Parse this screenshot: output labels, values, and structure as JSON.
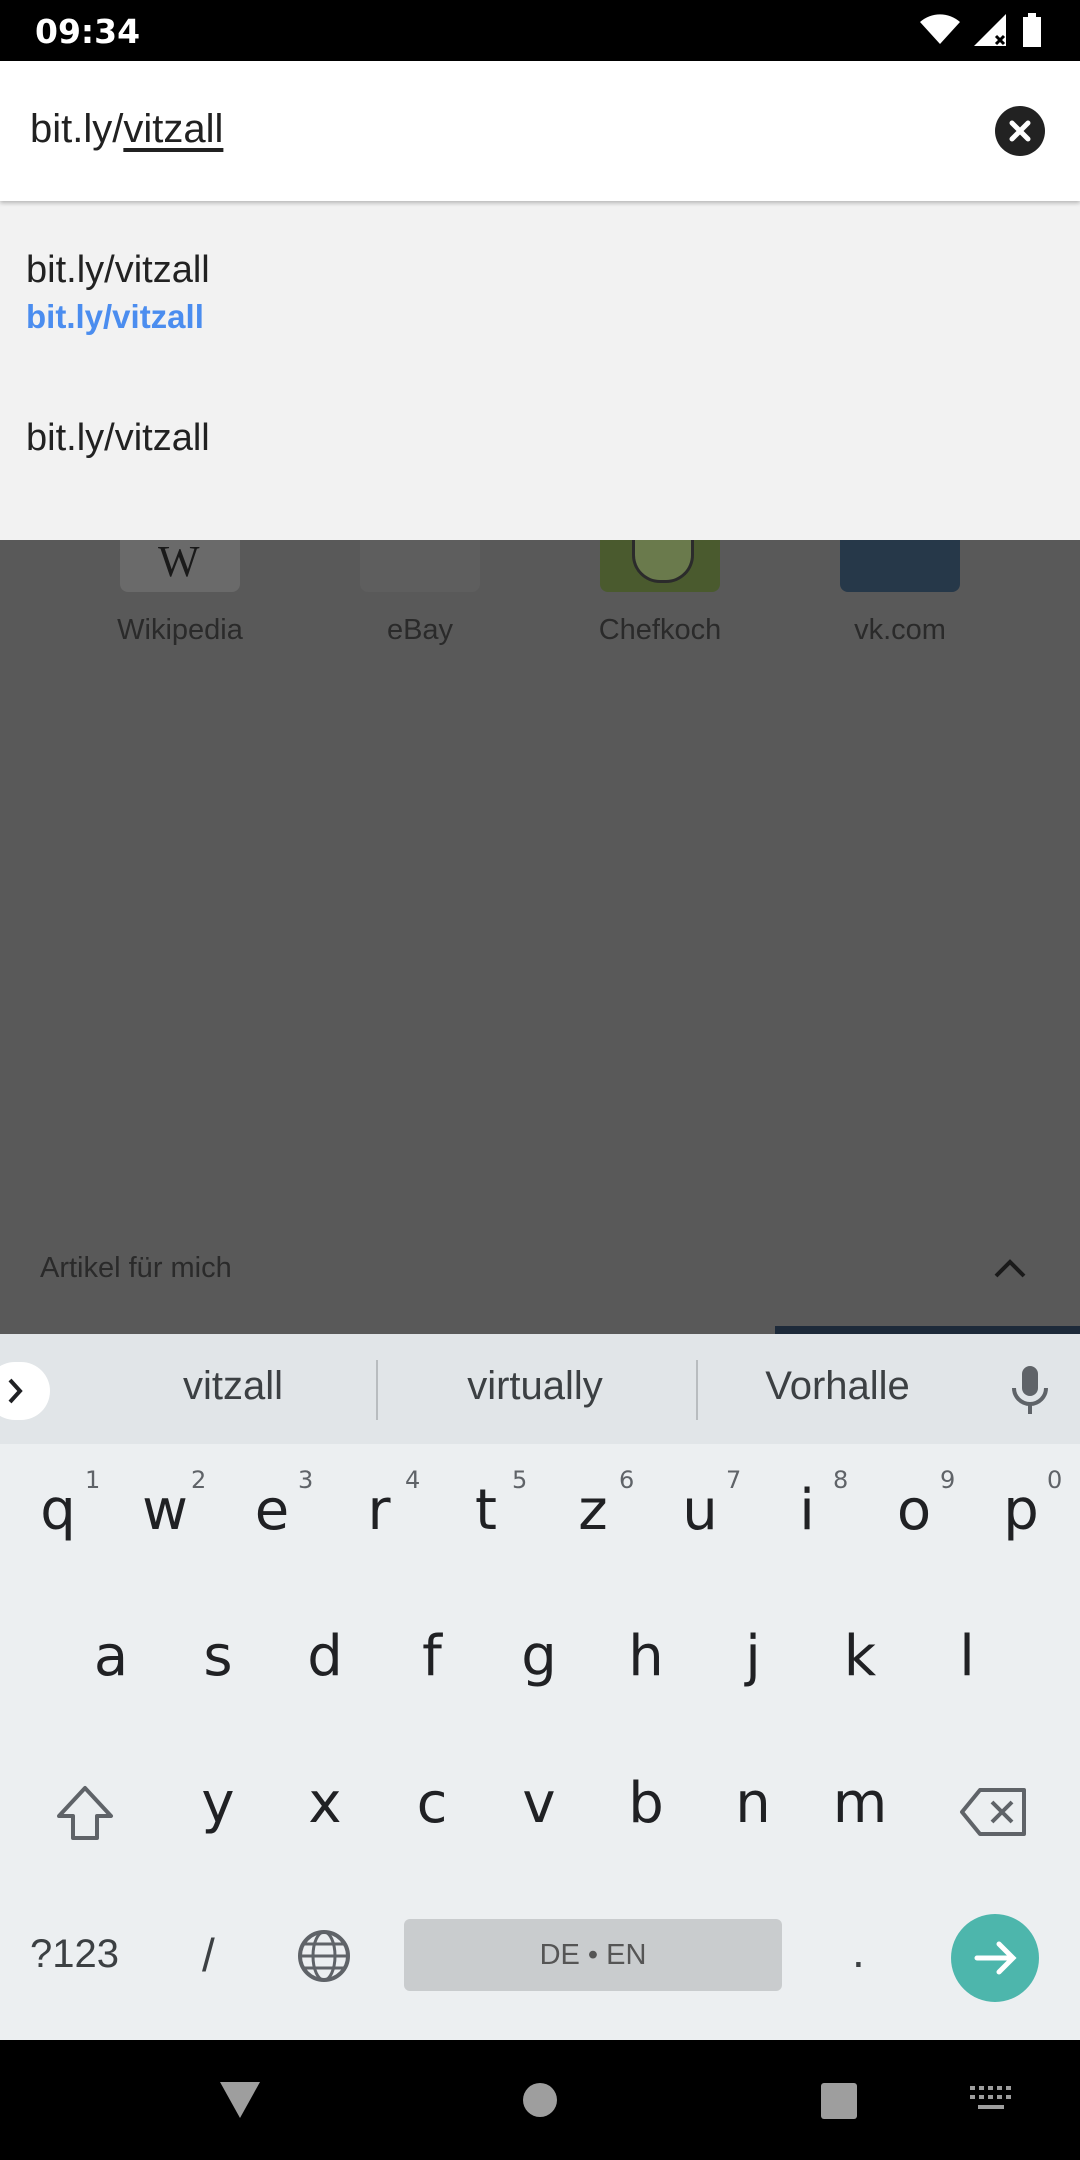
{
  "status_bar": {
    "time": "09:34",
    "icons": [
      "wifi-icon",
      "signal-icon",
      "battery-icon"
    ]
  },
  "url_bar": {
    "prefix": "bit.ly/",
    "typed": "vitzall"
  },
  "suggestions": [
    {
      "title": "bit.ly/vitzall",
      "url": "bit.ly/vitzall"
    },
    {
      "title": "bit.ly/vitzall"
    }
  ],
  "tiles": [
    {
      "label": "Wikipedia",
      "color": "#f0f0f0"
    },
    {
      "label": "eBay",
      "color": "#f4f4f4"
    },
    {
      "label": "Chefkoch",
      "color": "#8bc34a"
    },
    {
      "label": "vk.com",
      "color": "#4a76a8"
    }
  ],
  "articles": {
    "label": "Artikel für mich"
  },
  "keyboard": {
    "word_suggestions": [
      "vitzall",
      "virtually",
      "Vorhalle"
    ],
    "row1": [
      "q",
      "w",
      "e",
      "r",
      "t",
      "z",
      "u",
      "i",
      "o",
      "p"
    ],
    "row1_hints": [
      "1",
      "2",
      "3",
      "4",
      "5",
      "6",
      "7",
      "8",
      "9",
      "0"
    ],
    "row2": [
      "a",
      "s",
      "d",
      "f",
      "g",
      "h",
      "j",
      "k",
      "l"
    ],
    "row3": [
      "y",
      "x",
      "c",
      "v",
      "b",
      "n",
      "m"
    ],
    "symbols_key": "?123",
    "slash_key": "/",
    "space_label": "DE • EN",
    "period_key": ".",
    "accent_color": "#4db6ac"
  },
  "nav_bar": {
    "icons": [
      "back-icon",
      "home-icon",
      "recents-icon",
      "keyboard-switch-icon"
    ]
  }
}
